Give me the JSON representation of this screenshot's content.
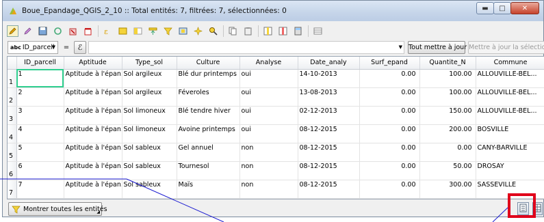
{
  "window": {
    "title": "Boue_Epandage_QGIS_2_10 :: Total entités: 7, filtrées: 7, sélectionnées: 0",
    "controls": [
      "minimize",
      "maximize",
      "close"
    ]
  },
  "toolbar": {
    "icons": [
      "edit-pencil-icon",
      "multi-edit-icon",
      "save-icon",
      "refresh-icon",
      "delete-icon",
      "delete-selected-icon",
      "expression-select-icon",
      "select-all-icon",
      "invert-selection-icon",
      "move-to-top-icon",
      "filter-icon",
      "zoom-to-selection-icon",
      "pan-to-selection-icon",
      "search-icon",
      "copy-icon",
      "paste-icon",
      "new-column-icon",
      "delete-column-icon",
      "calculator-icon",
      "conditional-format-icon"
    ]
  },
  "filter": {
    "field": "ID_parcell",
    "field_prefix": "abc",
    "operator": "=",
    "expression_symbol": "ℰ",
    "update_all_label": "Tout mettre à jour",
    "update_selection_label": "Mettre à jour la sélection"
  },
  "table": {
    "columns": [
      "ID_parcell",
      "Aptitude",
      "Type_sol",
      "Culture",
      "Analyse",
      "Date_analy",
      "Surf_epand",
      "Quantite_N",
      "Commune"
    ],
    "rows": [
      {
        "row": "1",
        "cells": [
          "1",
          "Aptitude à l'épan...",
          "Sol argileux",
          "Blé dur printemps",
          "oui",
          "14-10-2013",
          "0.00",
          "100.00",
          "ALLOUVILLE-BEL..."
        ]
      },
      {
        "row": "2",
        "cells": [
          "2",
          "Aptitude à l'épan...",
          "Sol argileux",
          "Féveroles",
          "oui",
          "13-08-2013",
          "0.00",
          "100.00",
          "ALLOUVILLE-BEL..."
        ]
      },
      {
        "row": "3",
        "cells": [
          "3",
          "Aptitude à l'épan...",
          "Sol limoneux",
          "Blé tendre hiver",
          "oui",
          "02-12-2013",
          "0.00",
          "150.00",
          "ALLOUVILLE-BEL..."
        ]
      },
      {
        "row": "4",
        "cells": [
          "4",
          "Aptitude à l'épan...",
          "Sol limoneux",
          "Avoine printemps",
          "oui",
          "08-12-2015",
          "0.00",
          "200.00",
          "BOSVILLE"
        ]
      },
      {
        "row": "5",
        "cells": [
          "5",
          "Aptitude à l'épan...",
          "Sol sableux",
          "Gel annuel",
          "non",
          "08-12-2015",
          "0.00",
          "0.00",
          "CANY-BARVILLE"
        ]
      },
      {
        "row": "6",
        "cells": [
          "6",
          "Aptitude à l'épan...",
          "Sol sableux",
          "Tournesol",
          "non",
          "08-12-2015",
          "0.00",
          "50.00",
          "DROSAY"
        ]
      },
      {
        "row": "7",
        "cells": [
          "7",
          "Aptitude à l'épan...",
          "Sol sableux",
          "Maïs",
          "non",
          "08-12-2015",
          "0.00",
          "300.00",
          "SASSEVILLE"
        ]
      }
    ]
  },
  "bottom": {
    "show_all_label": "Montrer toutes les entités",
    "view_buttons": [
      "form-view",
      "table-view"
    ]
  },
  "annotation_color": "#e0001a",
  "line_color": "#1a1ad0"
}
